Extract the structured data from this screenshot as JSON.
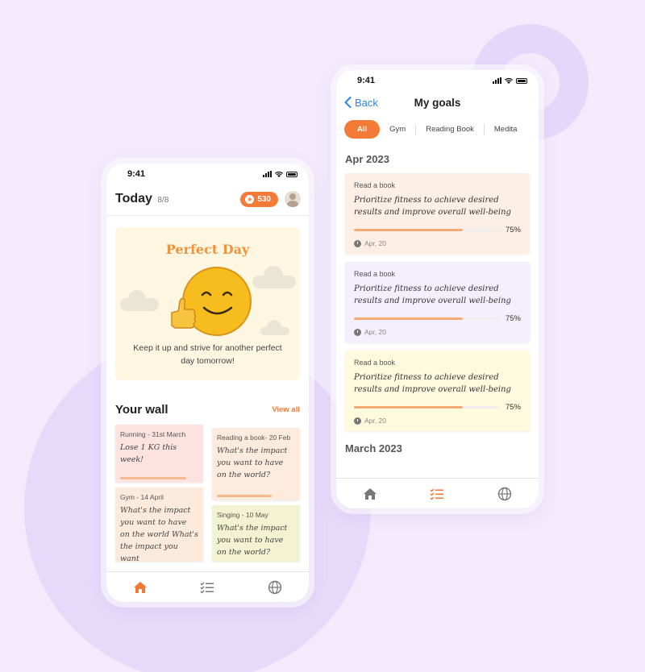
{
  "colors": {
    "accent": "#f47a37",
    "link": "#2e82e8",
    "background": "#f3eafc"
  },
  "left_phone": {
    "status_time": "9:41",
    "header": {
      "title": "Today",
      "count": "8/8",
      "points": "530"
    },
    "perfect_day": {
      "title": "Perfect Day",
      "message": "Keep it up and strive for another perfect day tomorrow!"
    },
    "wall": {
      "title": "Your wall",
      "view_all": "View all",
      "notes": [
        {
          "meta": "Running - 31st March",
          "body": "Lose 1 KG this week!",
          "color": "#fde3df",
          "progress": 0.85
        },
        {
          "meta": "Reading a book- 20 Feb",
          "body": "What's the impact you want to have on the world?",
          "color": "#fdebdd",
          "progress": 0.7
        },
        {
          "meta": "Gym - 14 April",
          "body": "What's the impact you want to have on the world What's the impact you want",
          "color": "#fcebdc",
          "progress": 0
        },
        {
          "meta": "Singing - 10 May",
          "body": "What's the impact you want to have on the world?",
          "color": "#f3f2d1",
          "progress": 0
        }
      ]
    },
    "tabs": [
      {
        "icon": "home-icon"
      },
      {
        "icon": "tasks-icon"
      },
      {
        "icon": "globe-icon"
      }
    ]
  },
  "right_phone": {
    "status_time": "9:41",
    "nav": {
      "back_label": "Back",
      "title": "My goals"
    },
    "filters": [
      "All",
      "Gym",
      "Reading Book",
      "Medita"
    ],
    "sections": [
      {
        "month": "Apr 2023",
        "goals": [
          {
            "kicker": "Read a book",
            "text": "Prioritize fitness to achieve desired results and improve overall well-being",
            "percent": "75%",
            "progress": 0.75,
            "date": "Apr, 20",
            "color": "#fdeee6"
          },
          {
            "kicker": "Read a book",
            "text": "Prioritize fitness to achieve desired results and improve overall well-being",
            "percent": "75%",
            "progress": 0.75,
            "date": "Apr, 20",
            "color": "#f3effd"
          },
          {
            "kicker": "Read a book",
            "text": "Prioritize fitness to achieve desired results and improve overall well-being",
            "percent": "75%",
            "progress": 0.75,
            "date": "Apr, 20",
            "color": "#fdfade"
          }
        ]
      },
      {
        "month": "March 2023",
        "goals": []
      }
    ],
    "tabs": [
      {
        "icon": "home-icon"
      },
      {
        "icon": "tasks-icon"
      },
      {
        "icon": "globe-icon"
      }
    ]
  }
}
